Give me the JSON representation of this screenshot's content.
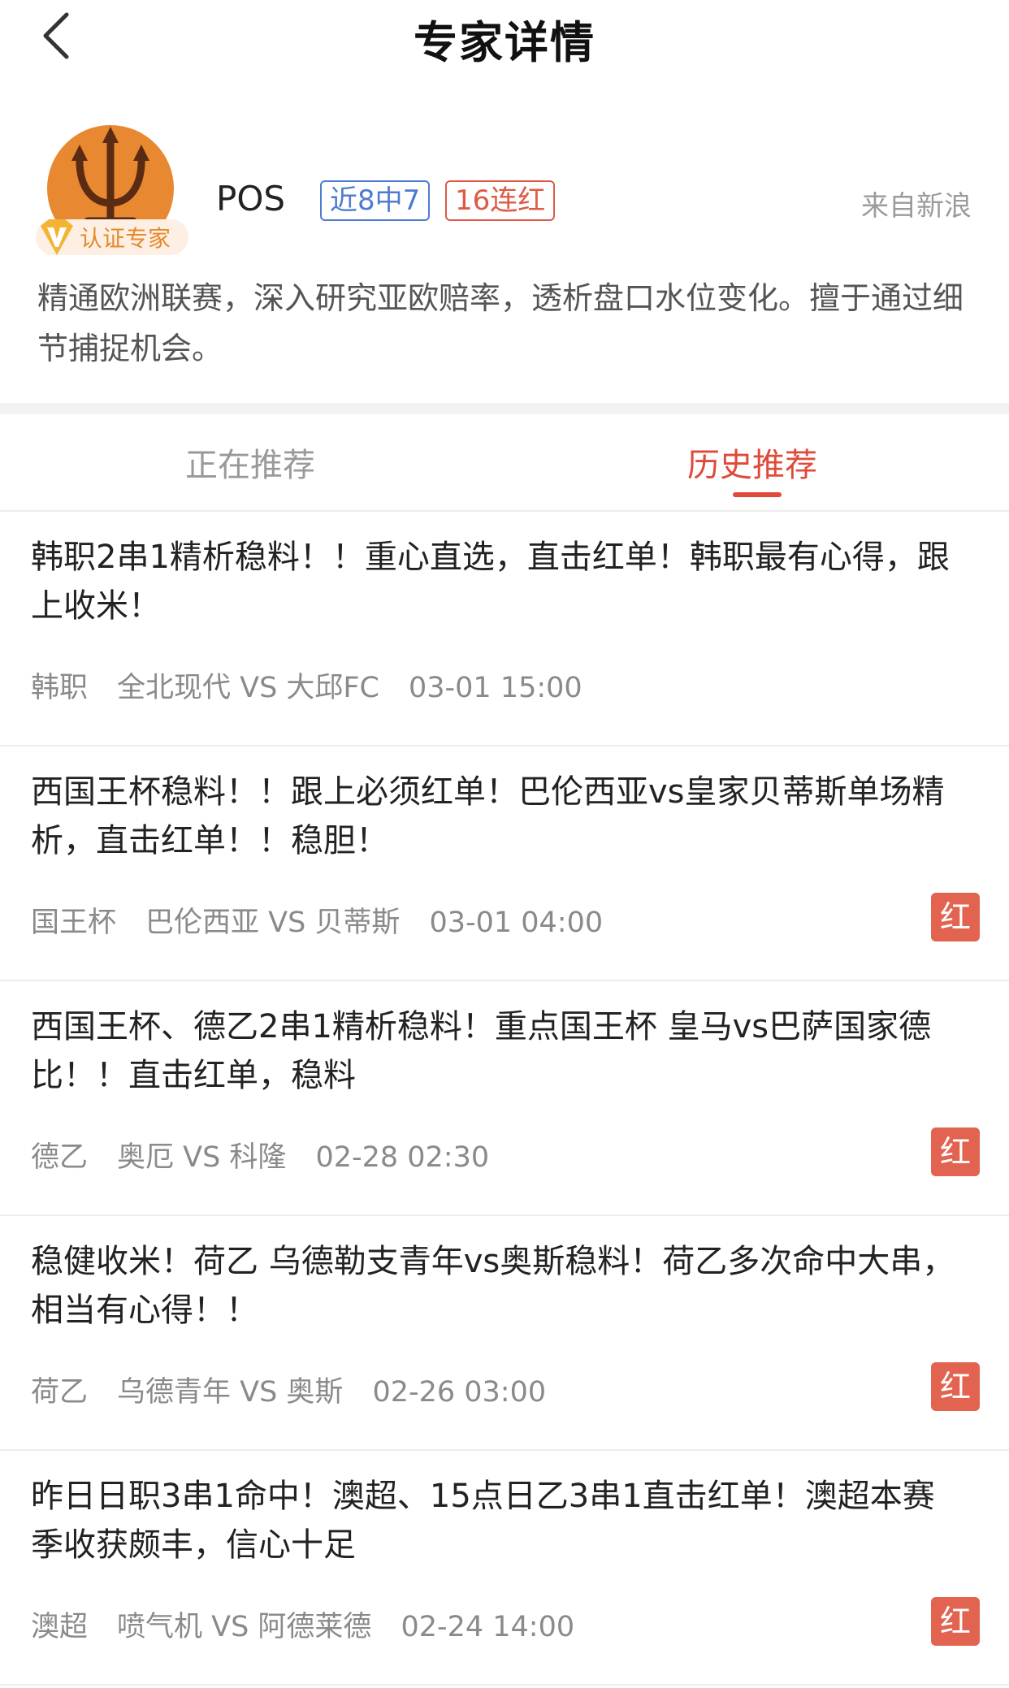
{
  "nav": {
    "title": "专家详情",
    "back_icon": "chevron-left-icon"
  },
  "profile": {
    "name": "POS",
    "badge": "认证专家",
    "tags": [
      "近8中7",
      "16连红"
    ],
    "source": "来自新浪",
    "description": "精通欧洲联赛，深入研究亚欧赔率，透析盘口水位变化。擅于通过细节捕捉机会。",
    "avatar_icon": "trident-icon",
    "colors": {
      "avatar_bg": "#E88830",
      "tag_blue": "#4E7BD2",
      "tag_red": "#DE5A46"
    }
  },
  "tabs": {
    "current": "正在推荐",
    "history": "历史推荐",
    "active": "history"
  },
  "items": [
    {
      "title": "韩职2串1精析稳料！！重心直选，直击红单！韩职最有心得，跟上收米！",
      "league": "韩职",
      "match": "全北现代 VS 大邱FC",
      "time": "03-01 15:00",
      "result": ""
    },
    {
      "title": "西国王杯稳料！！跟上必须红单！巴伦西亚vs皇家贝蒂斯单场精析，直击红单！！稳胆！",
      "league": "国王杯",
      "match": "巴伦西亚 VS 贝蒂斯",
      "time": "03-01 04:00",
      "result": "红"
    },
    {
      "title": "西国王杯、德乙2串1精析稳料！重点国王杯 皇马vs巴萨国家德比！！直击红单，稳料",
      "league": "德乙",
      "match": "奥厄 VS 科隆",
      "time": "02-28 02:30",
      "result": "红"
    },
    {
      "title": "稳健收米！荷乙 乌德勒支青年vs奥斯稳料！荷乙多次命中大串，相当有心得！！",
      "league": "荷乙",
      "match": "乌德青年 VS 奥斯",
      "time": "02-26 03:00",
      "result": "红"
    },
    {
      "title": "昨日日职3串1命中！澳超、15点日乙3串1直击红单！澳超本赛季收获颇丰，信心十足",
      "league": "澳超",
      "match": "喷气机 VS 阿德莱德",
      "time": "02-24 14:00",
      "result": "红"
    }
  ]
}
